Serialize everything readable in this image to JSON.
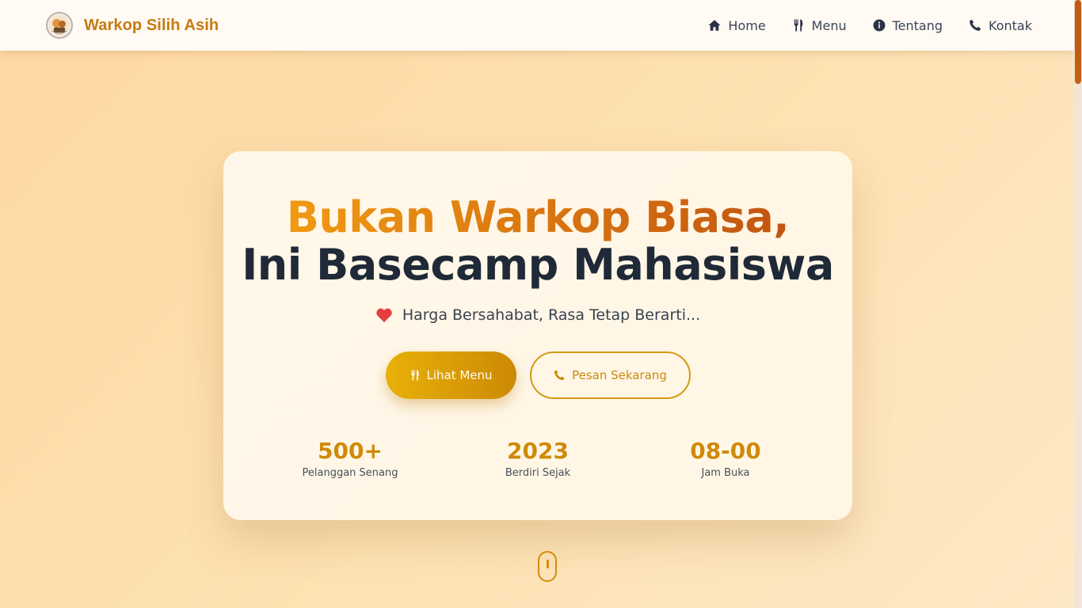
{
  "navbar": {
    "brand_name": "Warkop Silih Asih",
    "links": [
      {
        "label": "Home",
        "icon": "home-icon"
      },
      {
        "label": "Menu",
        "icon": "utensils-icon"
      },
      {
        "label": "Tentang",
        "icon": "info-icon"
      },
      {
        "label": "Kontak",
        "icon": "phone-icon"
      }
    ]
  },
  "hero": {
    "headline_line1": "Bukan Warkop Biasa,",
    "headline_line2": "Ini Basecamp Mahasiswa",
    "tagline": "Harga Bersahabat, Rasa Tetap Berarti...",
    "tagline_icon": "heart-icon",
    "primary_button": "Lihat Menu",
    "secondary_button": "Pesan Sekarang",
    "stats": [
      {
        "value": "500+",
        "label": "Pelanggan Senang"
      },
      {
        "value": "2023",
        "label": "Berdiri Sejak"
      },
      {
        "value": "08-00",
        "label": "Jam Buka"
      }
    ]
  },
  "colors": {
    "accent": "#cf8a09",
    "brand": "#c77a12",
    "headline_dark": "#1f2937",
    "heart": "#e53e3e"
  }
}
